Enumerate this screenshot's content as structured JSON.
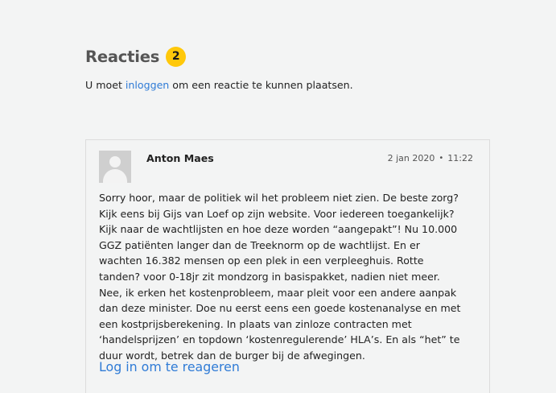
{
  "section": {
    "title": "Reacties",
    "count": "2",
    "login_prefix": "U moet ",
    "login_link": "inloggen",
    "login_suffix": " om een reactie te kunnen plaatsen."
  },
  "comments": [
    {
      "author": "Anton Maes",
      "date": "2 jan 2020",
      "separator": "•",
      "time": "11:22",
      "body": "Sorry hoor, maar de politiek wil het probleem niet zien. De beste zorg? Kijk eens bij Gijs van Loef op zijn website. Voor iedereen toegankelijk? Kijk naar de wachtlijsten en hoe deze worden “aangepakt”! Nu 10.000 GGZ patiënten langer dan de Treeknorm op de wachtlijst. En er wachten 16.382 mensen op een plek in een verpleeghuis. Rotte tanden? voor 0-18jr zit mondzorg in basispakket, nadien niet meer. Nee, ik erken het kostenprobleem, maar pleit voor een andere aanpak dan deze minister. Doe nu eerst eens een goede kostenanalyse en met een kostprijsberekening. In plaats van zinloze contracten met ‘handelsprijzen’ en topdown ‘kostenregulerende’ HLA’s. En als “het” te duur wordt, betrek dan de burger bij de afwegingen.",
      "reply_label": "Log in om te reageren"
    }
  ],
  "colors": {
    "accent": "#2f7bd6",
    "badge": "#ffc80a",
    "background": "#f3f4f4"
  }
}
